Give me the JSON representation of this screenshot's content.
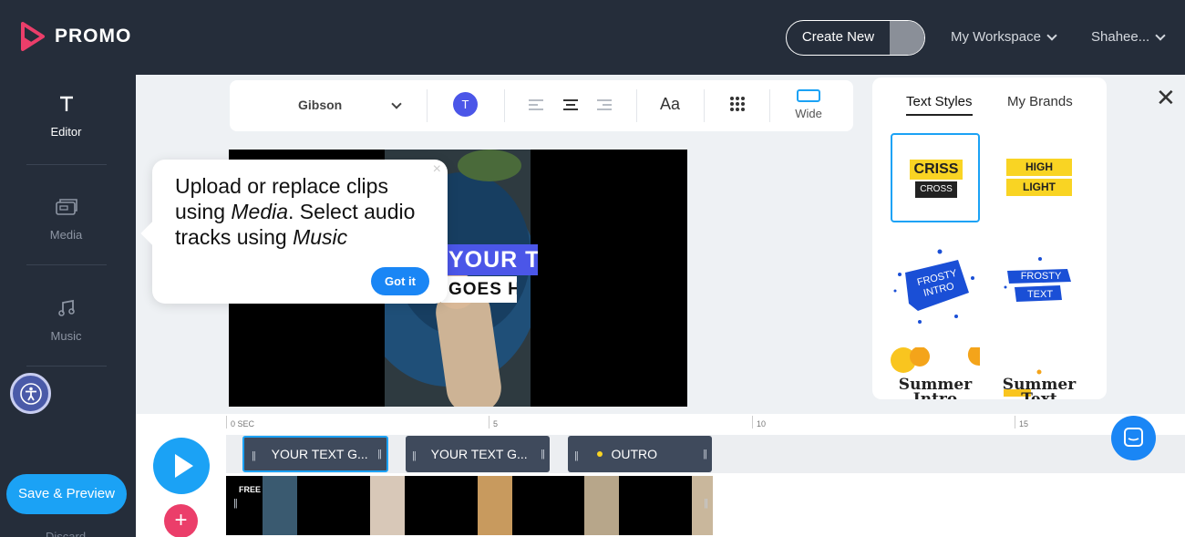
{
  "header": {
    "logo_text": "PROMO",
    "create_new_label": "Create New",
    "workspace_label": "My Workspace",
    "user_label": "Shahee..."
  },
  "sidebar": {
    "items": [
      {
        "label": "Editor",
        "icon": "text-t-icon",
        "active": true
      },
      {
        "label": "Media",
        "icon": "media-icon",
        "active": false
      },
      {
        "label": "Music",
        "icon": "music-note-icon",
        "active": false
      }
    ],
    "save_preview_label": "Save & Preview",
    "discard_label": "Discard"
  },
  "toolbar": {
    "font_name": "Gibson",
    "color_badge": "T",
    "aa_label": "Aa",
    "wide_label": "Wide",
    "text_color": "#4b56e8"
  },
  "canvas": {
    "overlay_line1": "YOUR TEXT",
    "overlay_line2": "GOES HERE"
  },
  "tooltip": {
    "line1": "Upload or replace clips",
    "line2_pre": "using ",
    "line2_em": "Media",
    "line2_post": ". Select audio",
    "line3_pre": "tracks using ",
    "line3_em": "Music",
    "button_label": "Got it",
    "close_symbol": "×"
  },
  "panel": {
    "tabs": [
      "Text Styles",
      "My Brands"
    ],
    "active_tab": "Text Styles",
    "styles": [
      {
        "line1": "CRISS",
        "line2": "CROSS",
        "selected": true
      },
      {
        "line1": "HIGH",
        "line2": "LIGHT",
        "selected": false
      },
      {
        "line1": "FROSTY",
        "line2": "INTRO",
        "selected": false
      },
      {
        "line1": "FROSTY",
        "line2": "TEXT",
        "selected": false
      },
      {
        "line1": "Summer",
        "line2": "Intro",
        "selected": false
      },
      {
        "line1": "Summer",
        "line2": "Text",
        "selected": false
      }
    ],
    "close_symbol": "✕"
  },
  "timeline": {
    "ruler": [
      {
        "label": "0 SEC"
      },
      {
        "label": "5"
      },
      {
        "label": "10"
      },
      {
        "label": "15"
      }
    ],
    "clips": [
      {
        "label": "YOUR TEXT G...",
        "selected": true
      },
      {
        "label": "YOUR TEXT G...",
        "selected": false
      },
      {
        "label": "OUTRO",
        "selected": false
      }
    ],
    "free_badge": "FREE",
    "add_symbol": "+"
  },
  "colors": {
    "brand_blue": "#1ba2f5",
    "dark_bg": "#252d3a",
    "accent_pink": "#eb3e6a",
    "highlight_yellow": "#f9d423"
  }
}
